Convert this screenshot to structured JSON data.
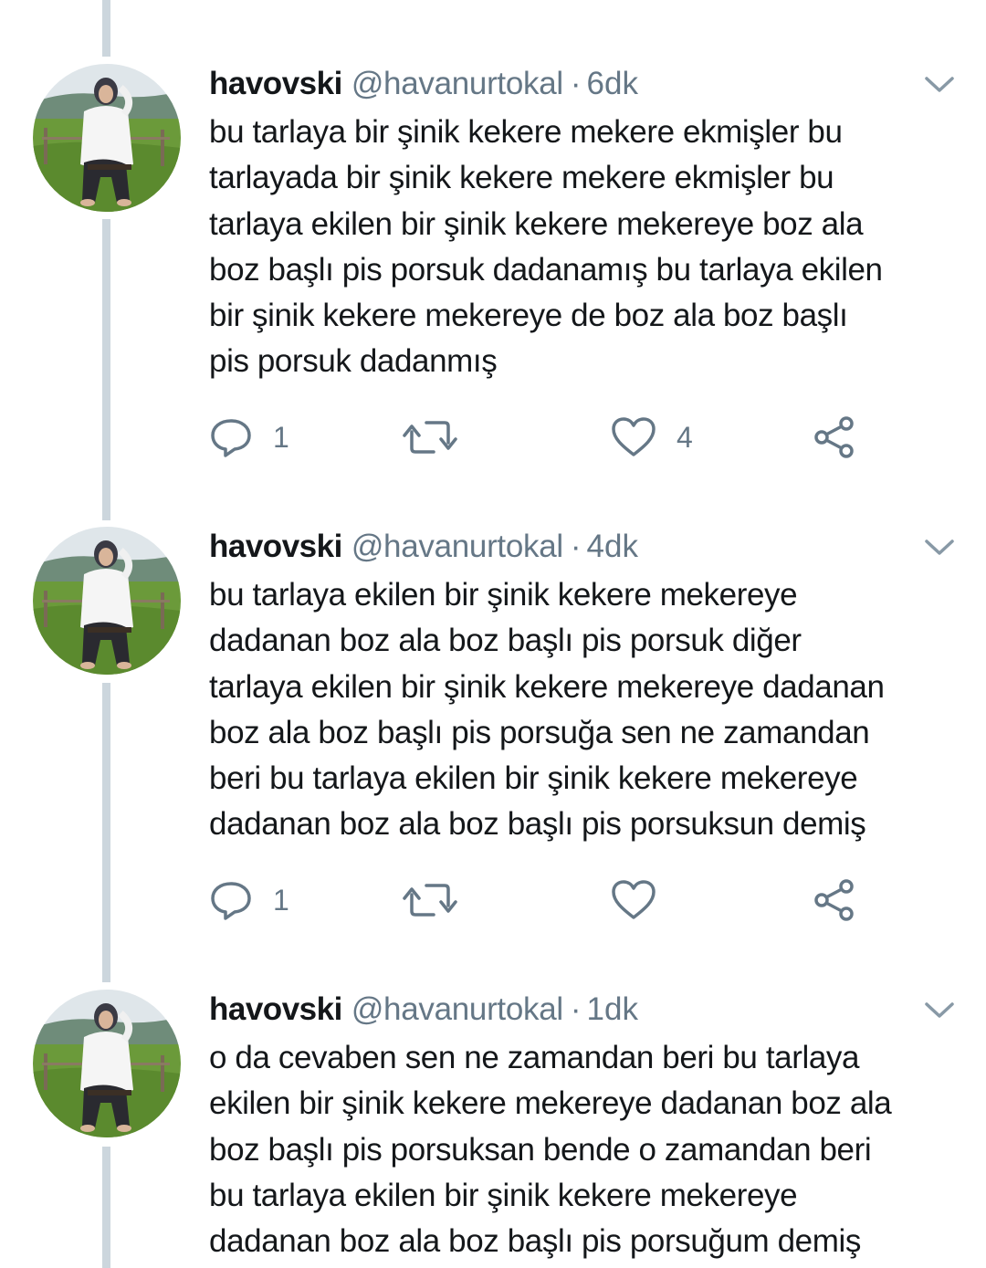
{
  "colors": {
    "thread_line": "#ccd6dd",
    "text_primary": "#14171a",
    "text_secondary": "#657786"
  },
  "tweets": [
    {
      "name": "havovski",
      "handle": "@havanurtokal",
      "separator": "·",
      "time": "6dk",
      "lines": [
        "bu tarlaya bir şinik kekere mekere ekmişler bu",
        "tarlayada bir şinik kekere mekere ekmişler bu",
        "tarlaya ekilen bir şinik kekere mekereye boz ala",
        "boz başlı pis porsuk dadanamış bu tarlaya ekilen",
        "bir şinik kekere mekereye de boz ala boz başlı",
        "pis porsuk dadanmış"
      ],
      "reply_count": "1",
      "retweet_count": "",
      "like_count": "4"
    },
    {
      "name": "havovski",
      "handle": "@havanurtokal",
      "separator": "·",
      "time": "4dk",
      "lines": [
        "bu tarlaya ekilen bir şinik kekere mekereye",
        "dadanan boz ala boz başlı pis porsuk diğer",
        "tarlaya ekilen bir şinik kekere mekereye dadanan",
        "boz ala boz başlı pis porsuğa sen ne zamandan",
        "beri bu tarlaya ekilen bir şinik kekere mekereye",
        "dadanan boz ala boz başlı pis porsuksun demiş"
      ],
      "reply_count": "1",
      "retweet_count": "",
      "like_count": ""
    },
    {
      "name": "havovski",
      "handle": "@havanurtokal",
      "separator": "·",
      "time": "1dk",
      "lines": [
        "o da cevaben sen ne zamandan beri bu tarlaya",
        "ekilen bir şinik kekere mekereye dadanan boz ala",
        "boz başlı pis porsuksan bende o zamandan beri",
        "bu tarlaya ekilen bir şinik kekere mekereye",
        "dadanan boz ala boz başlı pis porsuğum demiş"
      ],
      "reply_count": "",
      "retweet_count": "",
      "like_count": ""
    }
  ]
}
